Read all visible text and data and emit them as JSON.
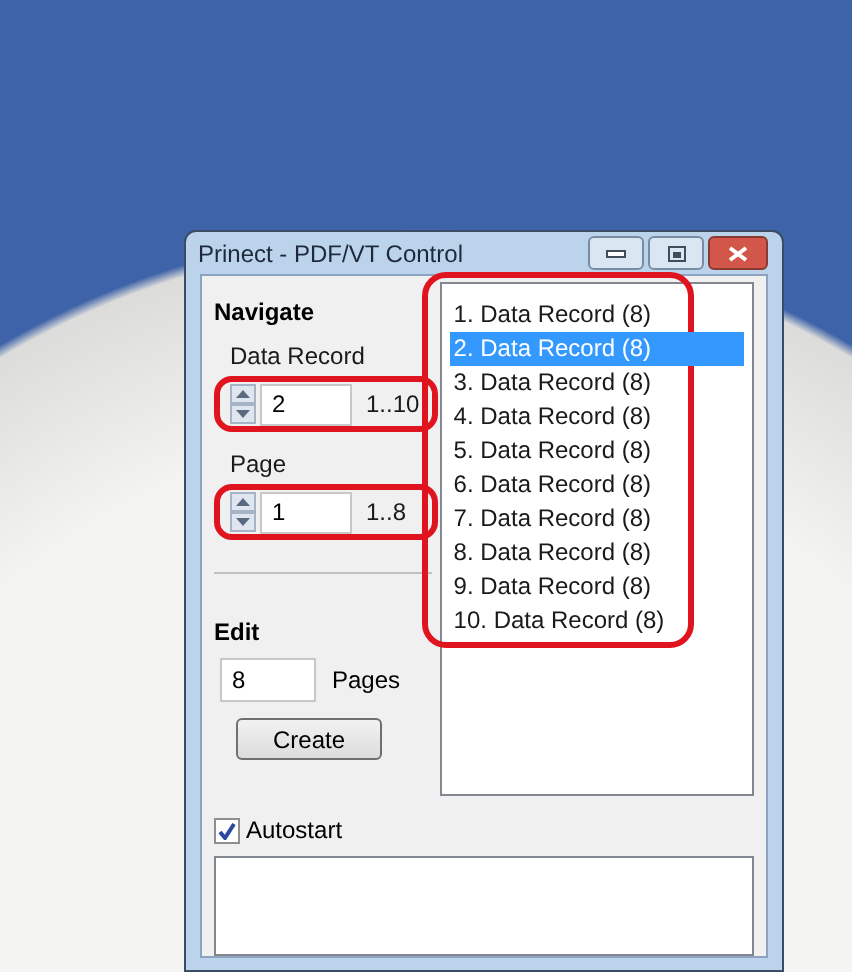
{
  "window": {
    "title": "Prinect - PDF/VT Control"
  },
  "navigate": {
    "heading": "Navigate",
    "data_record": {
      "label": "Data Record",
      "value": "2",
      "range": "1..10"
    },
    "page": {
      "label": "Page",
      "value": "1",
      "range": "1..8"
    }
  },
  "edit": {
    "heading": "Edit",
    "pages_value": "8",
    "pages_label": "Pages",
    "create_button": "Create"
  },
  "records": [
    {
      "label": "1. Data Record (8)",
      "selected": false
    },
    {
      "label": "2. Data Record (8)",
      "selected": true
    },
    {
      "label": "3. Data Record (8)",
      "selected": false
    },
    {
      "label": "4. Data Record (8)",
      "selected": false
    },
    {
      "label": "5. Data Record (8)",
      "selected": false
    },
    {
      "label": "6. Data Record (8)",
      "selected": false
    },
    {
      "label": "7. Data Record (8)",
      "selected": false
    },
    {
      "label": "8. Data Record (8)",
      "selected": false
    },
    {
      "label": "9. Data Record (8)",
      "selected": false
    },
    {
      "label": "10. Data Record (8)",
      "selected": false
    }
  ],
  "autostart": {
    "label": "Autostart",
    "checked": true
  }
}
